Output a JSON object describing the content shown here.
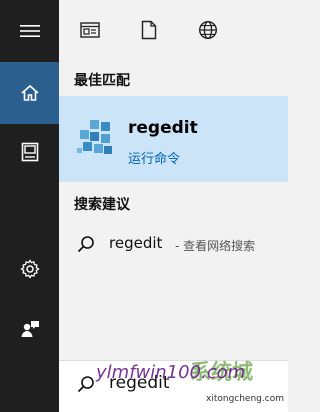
{
  "rail": {
    "items": [
      {
        "name": "hamburger-menu-icon"
      },
      {
        "name": "home-icon",
        "active": true
      },
      {
        "name": "notebook-icon"
      },
      {
        "name": "settings-gear-icon"
      },
      {
        "name": "user-feedback-icon"
      }
    ],
    "active_color": "#2b5f8e"
  },
  "filters": [
    {
      "name": "apps-filter-icon"
    },
    {
      "name": "documents-filter-icon"
    },
    {
      "name": "web-filter-icon"
    }
  ],
  "best_match": {
    "heading": "最佳匹配",
    "title": "regedit",
    "subtitle": "运行命令",
    "highlight_color": "#cce4f7",
    "icon": "regedit-cubes-icon"
  },
  "suggestions": {
    "heading": "搜索建议",
    "items": [
      {
        "query": "regedit",
        "hint": "- 查看网络搜索"
      }
    ]
  },
  "search_box": {
    "value": "regedit"
  },
  "watermark": {
    "brand": "ylmfwin100.com",
    "site_text": "系统城",
    "url": "xitongcheng.com"
  }
}
